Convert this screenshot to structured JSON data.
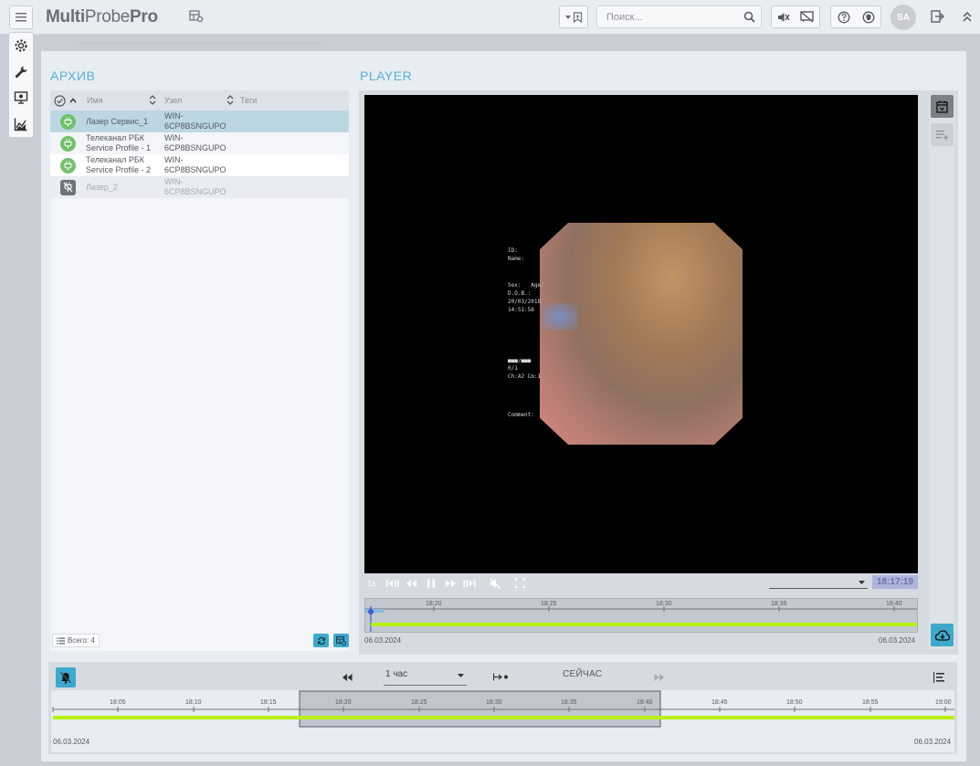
{
  "app": {
    "logo_multi": "Multi",
    "logo_probe": "Probe",
    "logo_pro": "Pro"
  },
  "search": {
    "placeholder": "Поиск..."
  },
  "user": {
    "initials": "SA"
  },
  "archive": {
    "title": "АРХИВ",
    "columns": {
      "name": "Имя",
      "node": "Узел",
      "tags": "Теги"
    },
    "rows": [
      {
        "name": "Лазер Сервис_1",
        "node": "WIN-6CP8BSNGUPO",
        "status": "online"
      },
      {
        "name": "Телеканал РБК Service Profile - 1",
        "node": "WIN-6CP8BSNGUPO",
        "status": "online"
      },
      {
        "name": "Телеканал РБК Service Profile - 2",
        "node": "WIN-6CP8BSNGUPO",
        "status": "online"
      },
      {
        "name": "Лазер_2",
        "node": "WIN-6CP8BSNGUPO",
        "status": "offline"
      }
    ],
    "total_label": "Всего: 4"
  },
  "player": {
    "title": "PLAYER",
    "speed": "1x",
    "clock": "18:17:19",
    "osd": {
      "id": "ID:",
      "name": "Name:",
      "sex_age": "Sex:   Age:",
      "dob": "D.O.B.:",
      "date": "20/03/2018",
      "time": "14:51:58",
      "frac": "0/1",
      "ch": "Ch:A2 Cm:1",
      "comment": "Comment:"
    },
    "timeline": {
      "ticks": [
        "18:20",
        "18:25",
        "18:30",
        "18:35",
        "18:40"
      ],
      "date_left": "06.03.2024",
      "date_right": "06.03.2024"
    }
  },
  "bottom": {
    "period": "1 час",
    "now_label": "СЕЙЧАС",
    "ticks": [
      "18:05",
      "18:10",
      "18:15",
      "18:20",
      "18:25",
      "18:30",
      "18:35",
      "18:40",
      "18:45",
      "18:50",
      "18:55",
      "19:00"
    ],
    "date_left": "06.03.2024",
    "date_right": "06.03.2024"
  },
  "colors": {
    "accent": "#3fa9cc",
    "timeline_green": "#b6f20f",
    "online": "#72c06c",
    "clock_bg": "#aeb5dd"
  }
}
